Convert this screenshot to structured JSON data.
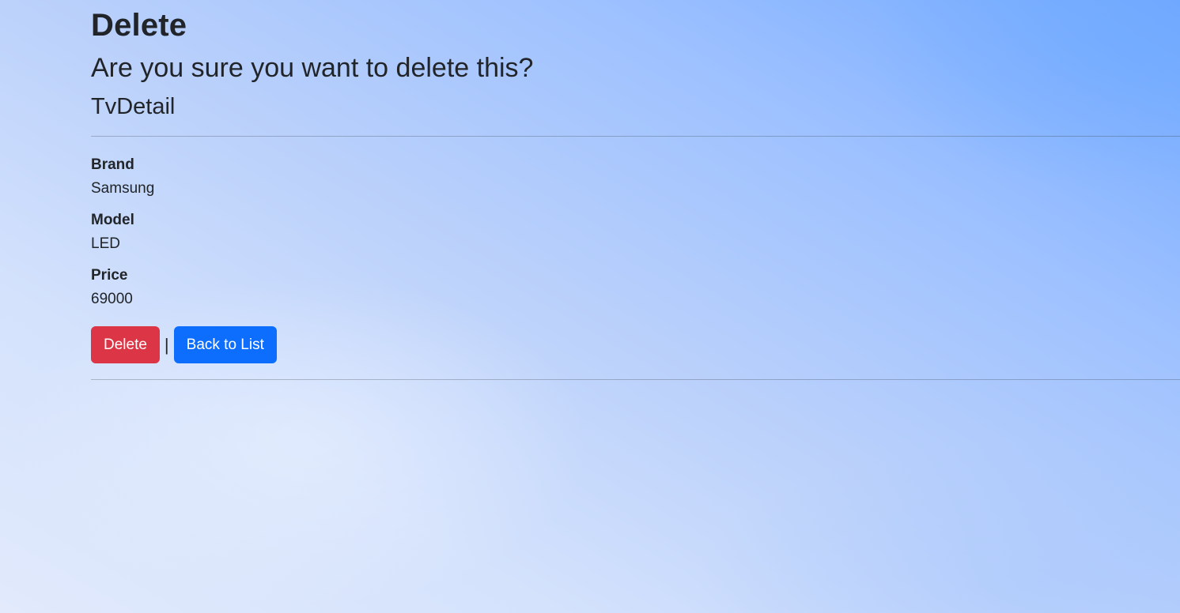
{
  "page": {
    "title": "Delete",
    "confirm_message": "Are you sure you want to delete this?",
    "entity_name": "TvDetail"
  },
  "details": [
    {
      "label": "Brand",
      "value": "Samsung"
    },
    {
      "label": "Model",
      "value": "LED"
    },
    {
      "label": "Price",
      "value": "69000"
    }
  ],
  "actions": {
    "delete_label": "Delete",
    "separator": "|",
    "back_label": "Back to List"
  },
  "colors": {
    "delete_button": "#dc3545",
    "back_button": "#0d6efd",
    "text": "#212529"
  }
}
